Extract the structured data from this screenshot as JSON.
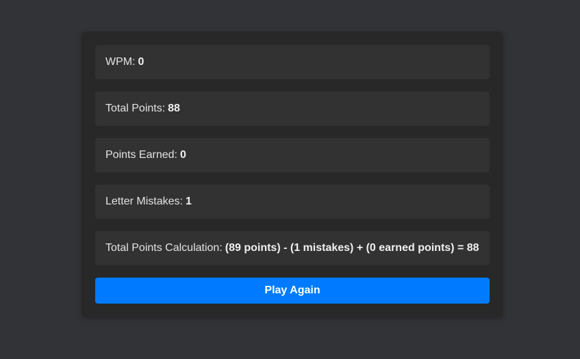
{
  "stats": [
    {
      "label": "WPM:",
      "value": "0"
    },
    {
      "label": "Total Points:",
      "value": "88"
    },
    {
      "label": "Points Earned:",
      "value": "0"
    },
    {
      "label": "Letter Mistakes:",
      "value": "1"
    },
    {
      "label": "Total Points Calculation:",
      "value": "(89 points) - (1 mistakes) + (0 earned points) = 88"
    }
  ],
  "play_again_label": "Play Again",
  "colors": {
    "background": "#323337",
    "card": "#282828",
    "stat_box": "#323232",
    "button": "#007bff"
  }
}
